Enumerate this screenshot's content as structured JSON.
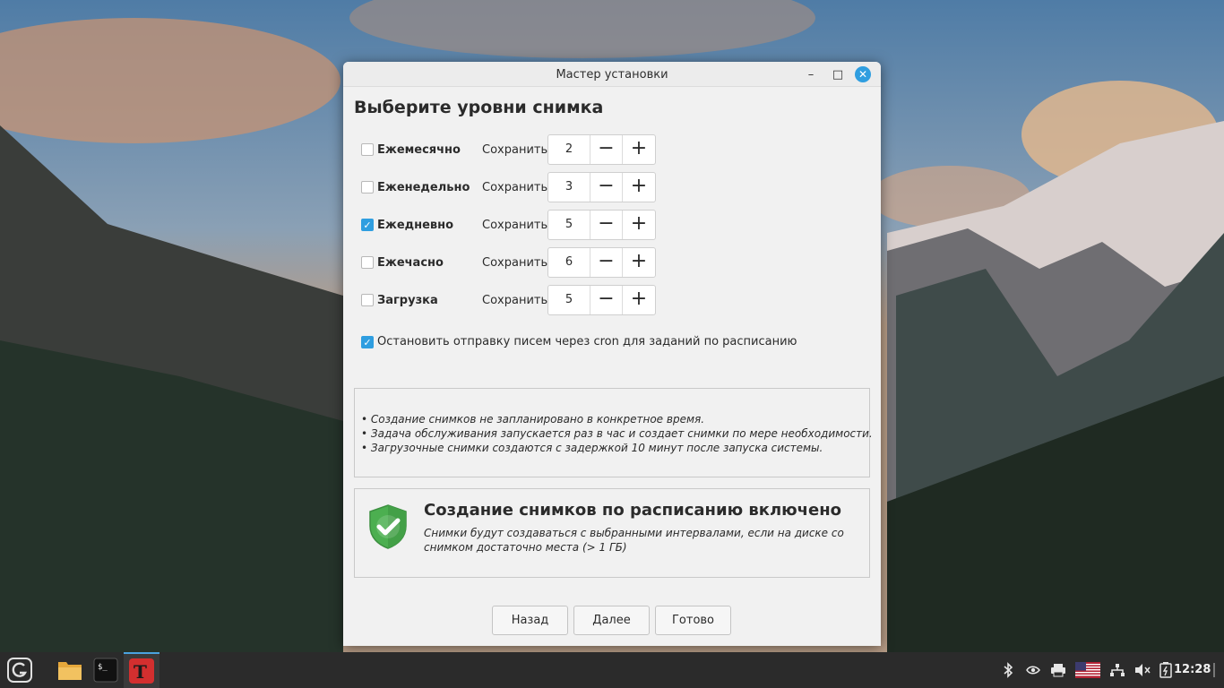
{
  "window": {
    "title": "Мастер установки",
    "controls": {
      "minimize": "–",
      "maximize": "□",
      "close": "✕"
    }
  },
  "heading": "Выберите уровни снимка",
  "keep_label": "Сохранить",
  "levels": [
    {
      "label": "Ежемесячно",
      "checked": false,
      "value": "2"
    },
    {
      "label": "Еженедельно",
      "checked": false,
      "value": "3"
    },
    {
      "label": "Ежедневно",
      "checked": true,
      "value": "5"
    },
    {
      "label": "Ежечасно",
      "checked": false,
      "value": "6"
    },
    {
      "label": "Загрузка",
      "checked": false,
      "value": "5"
    }
  ],
  "spin": {
    "minus": "−",
    "plus": "+"
  },
  "cron_option": {
    "label": "Остановить отправку писем через cron для заданий по расписанию",
    "checked": true
  },
  "notes": [
    "• Создание снимков не запланировано в конкретное время.",
    "• Задача обслуживания запускается раз в час и создает снимки по мере необходимости.",
    "• Загрузочные снимки создаются с задержкой 10 минут после запуска системы."
  ],
  "status": {
    "title": "Создание снимков по расписанию включено",
    "description": "Снимки будут создаваться с выбранными интервалами, если на диске со снимком достаточно места (> 1 ГБ)"
  },
  "buttons": {
    "back": "Назад",
    "next": "Далее",
    "finish": "Готово"
  },
  "taskbar": {
    "clock": "12:28",
    "apps": [
      "menu-icon",
      "files-icon",
      "terminal-icon",
      "timeshift-icon"
    ],
    "tray": [
      "bluetooth-icon",
      "nvidia-icon",
      "printer-icon",
      "keyboard-layout-flag-icon",
      "network-icon",
      "volume-icon",
      "battery-icon"
    ]
  },
  "colors": {
    "accent": "#2f9ee0",
    "shield": "#4caf50",
    "taskbar": "#2b2b2b"
  }
}
